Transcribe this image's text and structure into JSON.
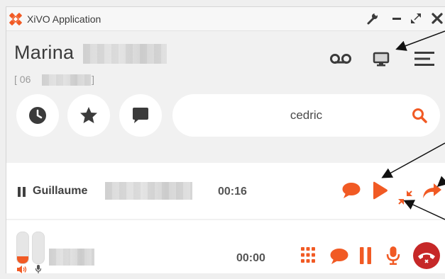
{
  "window": {
    "title": "XiVO Application"
  },
  "user": {
    "first_name": "Marina",
    "phone_prefix": "[ 06",
    "phone_suffix": "]"
  },
  "search": {
    "value": "cedric"
  },
  "calls": [
    {
      "state": "on-hold",
      "name": "Guillaume",
      "duration": "00:16"
    },
    {
      "state": "active",
      "name": "",
      "duration": "00:00"
    }
  ],
  "colors": {
    "accent": "#f15a24",
    "hangup": "#c62828",
    "text": "#3b3b3b",
    "annotation_arrow": "#111111"
  },
  "icons": {
    "header": [
      "voicemail-icon",
      "screen-icon",
      "menu-icon"
    ],
    "toolbar": [
      "history-icon",
      "favorites-icon",
      "chat-icon",
      "search-icon"
    ],
    "row1_actions": [
      "chat-icon",
      "resume-icon",
      "attended-transfer-icon",
      "transfer-icon"
    ],
    "row2_actions": [
      "dialpad-icon",
      "chat-icon",
      "hold-icon",
      "mute-icon",
      "hangup-icon"
    ]
  }
}
